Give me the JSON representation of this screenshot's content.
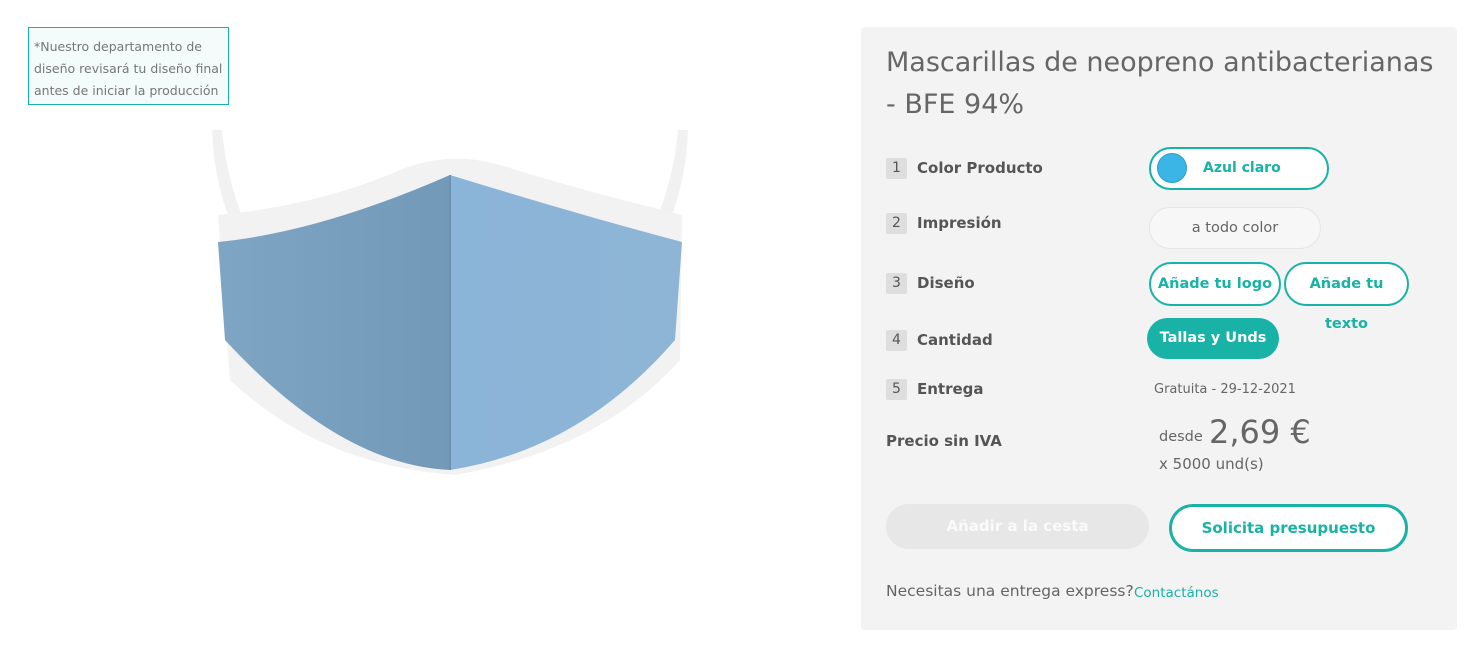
{
  "notice": {
    "line1": "*Nuestro departamento de",
    "line2": "diseño revisará tu diseño final",
    "line3": "antes de iniciar la producción"
  },
  "product": {
    "title": "Mascarillas de neopreno antibacterianas - BFE 94%",
    "image_icon": "face-mask-image",
    "mask_color": "#8bb3d6"
  },
  "steps": [
    {
      "num": "1",
      "label": "Color Producto"
    },
    {
      "num": "2",
      "label": "Impresión"
    },
    {
      "num": "3",
      "label": "Diseño"
    },
    {
      "num": "4",
      "label": "Cantidad"
    },
    {
      "num": "5",
      "label": "Entrega"
    }
  ],
  "options": {
    "color": {
      "label": "Azul claro",
      "swatch": "#3bb5e6"
    },
    "print": "a todo color",
    "design_logo": "Añade tu logo",
    "design_text": "Añade tu texto",
    "quantity": "Tallas y Unds",
    "delivery": "Gratuita - 29-12-2021"
  },
  "price": {
    "label": "Precio sin IVA",
    "prefix": "desde",
    "value": "2,69 €",
    "quantity": "x 5000 und(s)"
  },
  "actions": {
    "add_to_cart": "Añadir a la cesta",
    "request_quote": "Solicita presupuesto"
  },
  "express": {
    "question": "Necesitas una entrega express?",
    "link": "Contactános"
  },
  "colors": {
    "accent": "#19b2a6",
    "panel_bg": "#f3f3f3",
    "disabled": "#e7e7e7"
  }
}
